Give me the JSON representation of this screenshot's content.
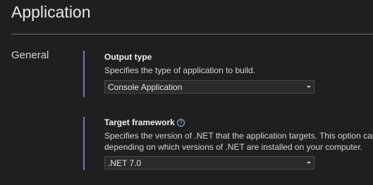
{
  "page": {
    "title": "Application"
  },
  "section": {
    "label": "General"
  },
  "output_type": {
    "title": "Output type",
    "description": "Specifies the type of application to build.",
    "selected": "Console Application"
  },
  "target_framework": {
    "title": "Target framework",
    "description_line1": "Specifies the version of .NET that the application targets. This option can",
    "description_line2": "depending on which versions of .NET are installed on your computer.",
    "selected": ".NET 7.0"
  },
  "colors": {
    "background": "#1f1f1f",
    "accent": "#8a68c8",
    "dropdown_bg": "#2b2b2b"
  }
}
